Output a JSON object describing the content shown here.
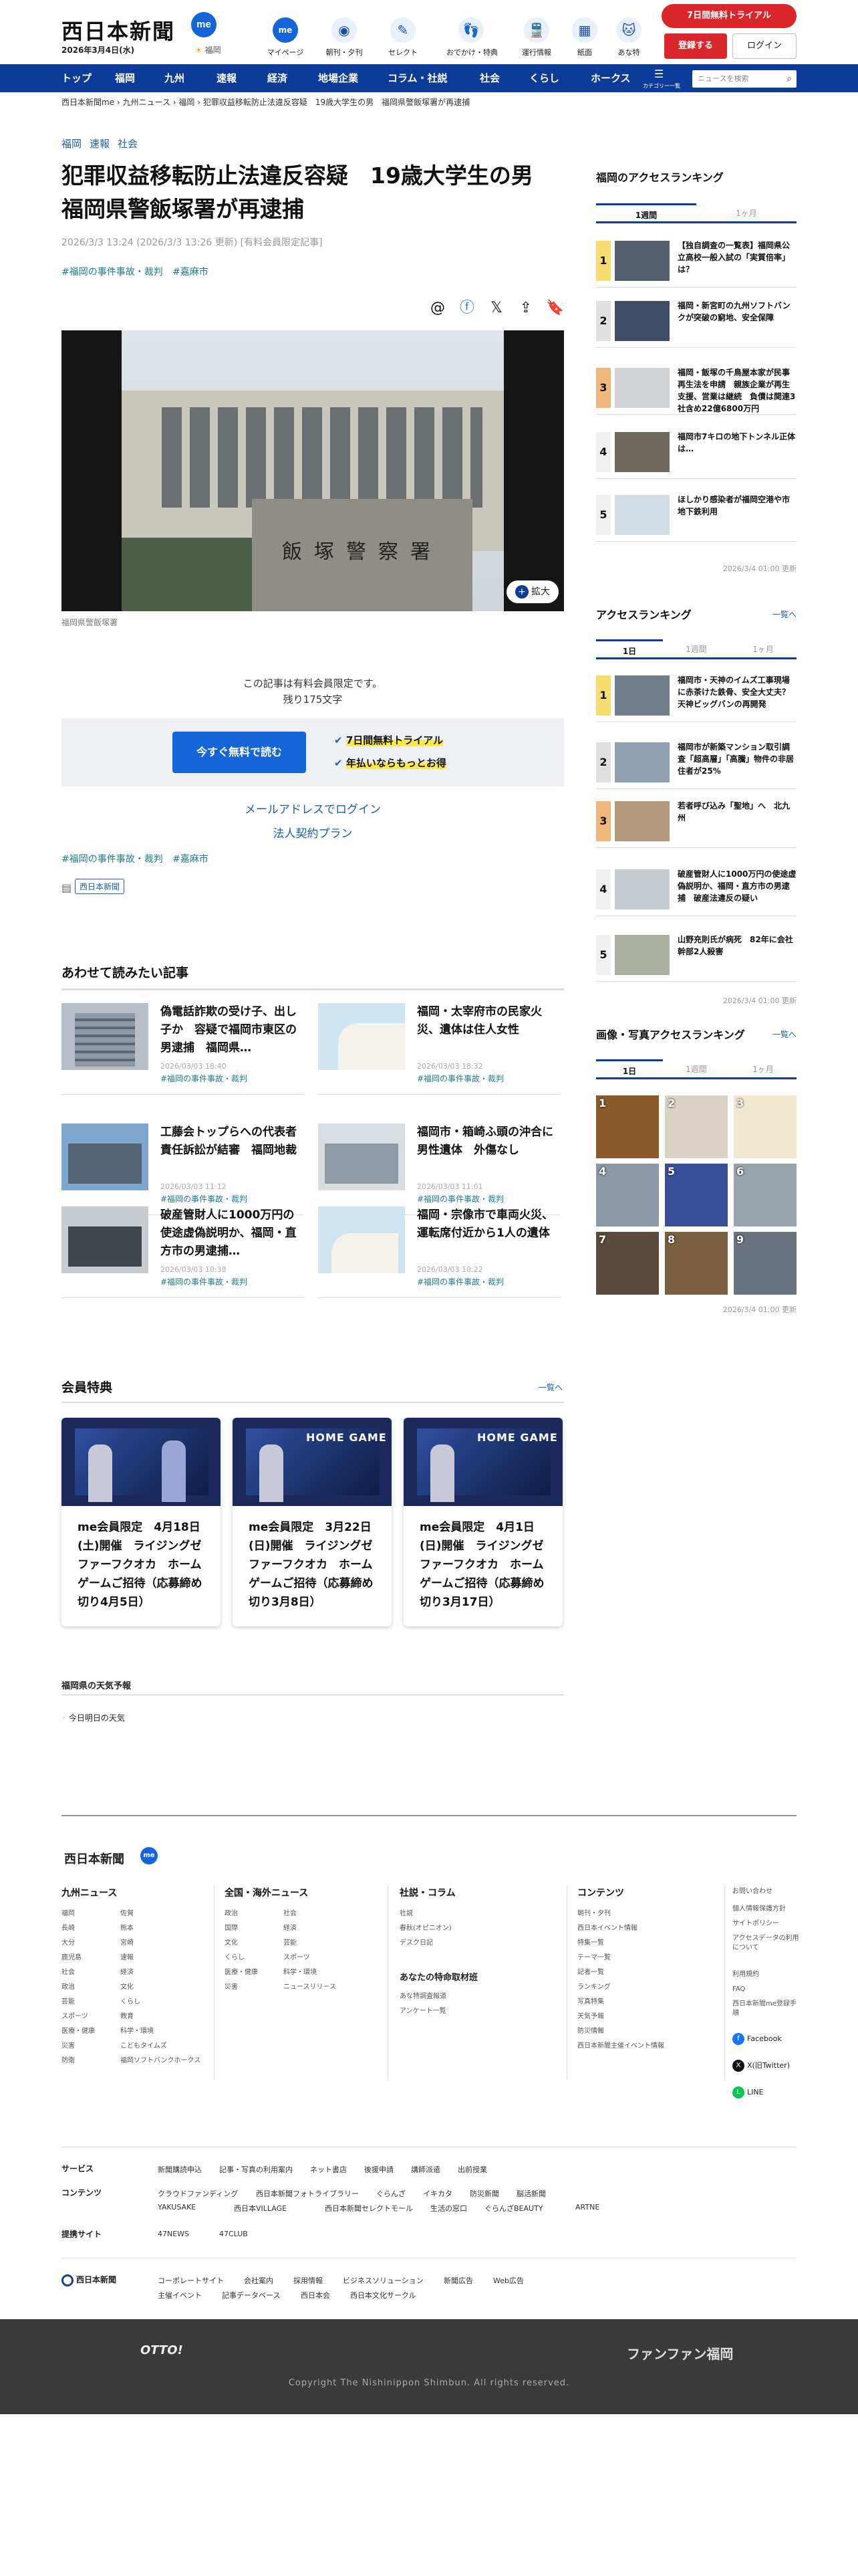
{
  "header": {
    "logo": "西日本新聞",
    "logo_badge": "me",
    "date": "2026年3月4日(水)",
    "weather_city": "福岡",
    "nav": [
      {
        "label": "マイページ",
        "icon": "person-icon",
        "glyph": "me"
      },
      {
        "label": "朝刊・夕刊",
        "icon": "newspaper-icon",
        "glyph": "◉"
      },
      {
        "label": "セレクト",
        "icon": "select-icon",
        "glyph": "✎"
      },
      {
        "label": "おでかけ・特典",
        "icon": "footprint-icon",
        "glyph": "👣"
      },
      {
        "label": "運行情報",
        "icon": "train-icon",
        "glyph": "🚆"
      },
      {
        "label": "紙面",
        "icon": "paper-icon",
        "glyph": "▦"
      },
      {
        "label": "あな特",
        "icon": "mascot-icon",
        "glyph": "🐱"
      }
    ],
    "trial_button": "7日間無料トライアル",
    "register_button": "登録する",
    "login_button": "ログイン"
  },
  "global_nav": {
    "items": [
      "トップ",
      "福岡",
      "九州",
      "速報",
      "経済",
      "地場企業",
      "コラム・社説",
      "社会",
      "くらし",
      "ホークス"
    ],
    "menu_label": "カテゴリー一覧",
    "search_placeholder": "ニュースを検索"
  },
  "breadcrumb": [
    "西日本新聞me",
    "九州ニュース",
    "福岡",
    "犯罪収益移転防止法違反容疑　19歳大学生の男　福岡県警飯塚署が再逮捕"
  ],
  "article": {
    "categories": [
      "福岡",
      "速報",
      "社会"
    ],
    "title": "犯罪収益移転防止法違反容疑　19歳大学生の男　福岡県警飯塚署が再逮捕",
    "meta": "2026/3/3 13:24 (2026/3/3 13:26 更新) [有料会員限定記事]",
    "tags": [
      "#福岡の事件事故・裁判",
      "#嘉麻市"
    ],
    "photo_sign": "飯塚警察署",
    "zoom_label": "拡大",
    "caption": "福岡県警飯塚署",
    "paywall_line1": "この記事は有料会員限定です。",
    "paywall_line2": "残り175文字",
    "read_button": "今すぐ無料で読む",
    "benefit1": "7日間無料トライアル",
    "benefit2": "年払いならもっとお得",
    "email_login": "メールアドレスでログイン",
    "corporate": "法人契約プラン",
    "tags_bottom": [
      "#福岡の事件事故・裁判",
      "#嘉麻市"
    ],
    "publisher": "西日本新聞"
  },
  "related": {
    "heading": "あわせて読みたい記事",
    "items": [
      {
        "title": "偽電話詐欺の受け子、出し子か　容疑で福岡市東区の男逮捕　福岡県…",
        "date": "2026/03/03 18:40",
        "tag": "#福岡の事件事故・裁判"
      },
      {
        "title": "福岡・太宰府市の民家火災、遺体は住人女性",
        "date": "2026/03/03 18:32",
        "tag": "#福岡の事件事故・裁判"
      },
      {
        "title": "工藤会トップらへの代表者責任訴訟が結審　福岡地裁",
        "date": "2026/03/03 11:12",
        "tag": "#福岡の事件事故・裁判"
      },
      {
        "title": "福岡市・箱崎ふ頭の沖合に男性遺体　外傷なし",
        "date": "2026/03/03 11:01",
        "tag": "#福岡の事件事故・裁判"
      },
      {
        "title": "破産管財人に1000万円の使途虚偽説明か、福岡・直方市の男逮捕…",
        "date": "2026/03/03 10:38",
        "tag": "#福岡の事件事故・裁判"
      },
      {
        "title": "福岡・宗像市で車両火災、運転席付近から1人の遺体",
        "date": "2026/03/03 10:22",
        "tag": "#福岡の事件事故・裁判"
      }
    ]
  },
  "member": {
    "heading": "会員特典",
    "more": "一覧へ",
    "cards": [
      {
        "title": "me会員限定　4月18日(土)開催　ライジングゼファーフクオカ　ホームゲームご招待（応募締め切り4月5日）",
        "banner": ""
      },
      {
        "title": "me会員限定　3月22日(日)開催　ライジングゼファーフクオカ　ホームゲームご招待（応募締め切り3月8日）",
        "banner": "HOME GAME"
      },
      {
        "title": "me会員限定　4月1日(日)開催　ライジングゼファーフクオカ　ホームゲームご招待（応募締め切り3月17日）",
        "banner": "HOME GAME"
      }
    ]
  },
  "weather": {
    "heading": "福岡県の天気予報",
    "item": "今日明日の天気"
  },
  "sidebar": {
    "fukuoka_ranking": {
      "heading": "福岡のアクセスランキング",
      "tabs": [
        "1週間",
        "1ヶ月"
      ],
      "items": [
        "【独自調査の一覧表】福岡県公立高校一般入試の「実質倍率」は？",
        "福岡・新宮町の九州ソフトバンクが突破の窮地、安全保障",
        "福岡・飯塚の千鳥屋本家が民事再生法を申請　親族企業が再生支援、営業は継続　負債は関連3社含め22億6800万円",
        "福岡市7キロの地下トンネル正体は…",
        "ほしかり感染者が福岡空港や市地下鉄利用"
      ],
      "updated": "2026/3/4 01:00 更新"
    },
    "access_ranking": {
      "heading": "アクセスランキング",
      "more": "一覧へ",
      "tabs": [
        "1日",
        "1週間",
        "1ヶ月"
      ],
      "items": [
        "福岡市・天神のイムズ工事現場に赤茶けた鉄骨、安全大丈夫？天神ビッグバンの再開発",
        "福岡市が新築マンション取引調査「超高層」「高騰」物件の非居住者が25%",
        "若者呼び込み「聖地」へ　北九州",
        "破産管財人に1000万円の使途虚偽説明か、福岡・直方市の男逮捕　破産法違反の疑い",
        "山野充則氏が病死　82年に会社幹部2人殺害"
      ],
      "updated": "2026/3/4 01:00 更新"
    },
    "photo_ranking": {
      "heading": "画像・写真アクセスランキング",
      "more": "一覧へ",
      "tabs": [
        "1日",
        "1週間",
        "1ヶ月"
      ],
      "numbers": [
        "1",
        "2",
        "3",
        "4",
        "5",
        "6",
        "7",
        "8",
        "9"
      ],
      "updated": "2026/3/4 01:00 更新"
    }
  },
  "footer": {
    "logo": "西日本新聞",
    "cols": [
      {
        "heading": "九州ニュース",
        "links": [
          "福岡",
          "佐賀",
          "長崎",
          "熊本",
          "大分",
          "宮崎",
          "鹿児島",
          "速報",
          "社会",
          "経済",
          "政治",
          "文化",
          "芸能",
          "くらし",
          "スポーツ",
          "教育",
          "医療・健康",
          "科学・環境",
          "災害",
          "こどもタイムズ",
          "防衛",
          "福岡ソフトバンクホークス"
        ]
      },
      {
        "heading": "全国・海外ニュース",
        "links": [
          "政治",
          "社会",
          "国際",
          "経済",
          "文化",
          "芸能",
          "くらし",
          "スポーツ",
          "医療・健康",
          "科学・環境",
          "災害",
          "ニュースリリース"
        ]
      },
      {
        "heading": "社説・コラム",
        "links": [
          "社説",
          "春秋(オピニオン)",
          "デスク日記"
        ]
      },
      {
        "heading": "コンテンツ",
        "links": [
          "朝刊・夕刊",
          "西日本イベント情報",
          "特集一覧",
          "テーマ一覧",
          "記者一覧",
          "ランキング",
          "写真特集",
          "天気予報",
          "防災情報",
          "西日本新聞主催イベント情報"
        ]
      }
    ],
    "col3_sub_heading": "あなたの特命取材班",
    "col3_sub_links": [
      "あな特調査報道",
      "アンケート一覧"
    ],
    "right_links": [
      "お問い合わせ",
      "個人情報保護方針",
      "サイトポリシー",
      "アクセスデータの利用について",
      "利用規約",
      "FAQ",
      "西日本新聞me登録手順"
    ],
    "social": [
      "Facebook",
      "X(旧Twitter)",
      "LINE"
    ],
    "rows": [
      {
        "heading": "サービス",
        "links": [
          "新聞購読申込",
          "記事・写真の利用案内",
          "ネット書店",
          "後援申請",
          "講師派遣",
          "出前授業"
        ]
      },
      {
        "heading": "コンテンツ",
        "links": [
          "クラウドファンディング",
          "西日本新聞フォトライブラリー",
          "ぐらんざ",
          "イキカタ",
          "防災新聞",
          "脳活新聞",
          "YAKUSAKE",
          "西日本VILLAGE",
          "西日本新聞セレクトモール",
          "生活の窓口",
          "ぐらんざBEAUTY",
          "ARTNE"
        ]
      },
      {
        "heading": "提携サイト",
        "links": [
          "47NEWS",
          "47CLUB"
        ]
      }
    ],
    "corp_name": "西日本新聞",
    "corp_links": [
      "コーポレートサイト",
      "会社案内",
      "採用情報",
      "ビジネスソリューション",
      "新聞広告",
      "Web広告",
      "主催イベント",
      "記事データベース",
      "西日本会",
      "西日本文化サークル"
    ],
    "otto": "OTTO!",
    "fanfan": "ファンファン福岡",
    "copyright": "Copyright The Nishinippon Shimbun. All rights reserved."
  }
}
